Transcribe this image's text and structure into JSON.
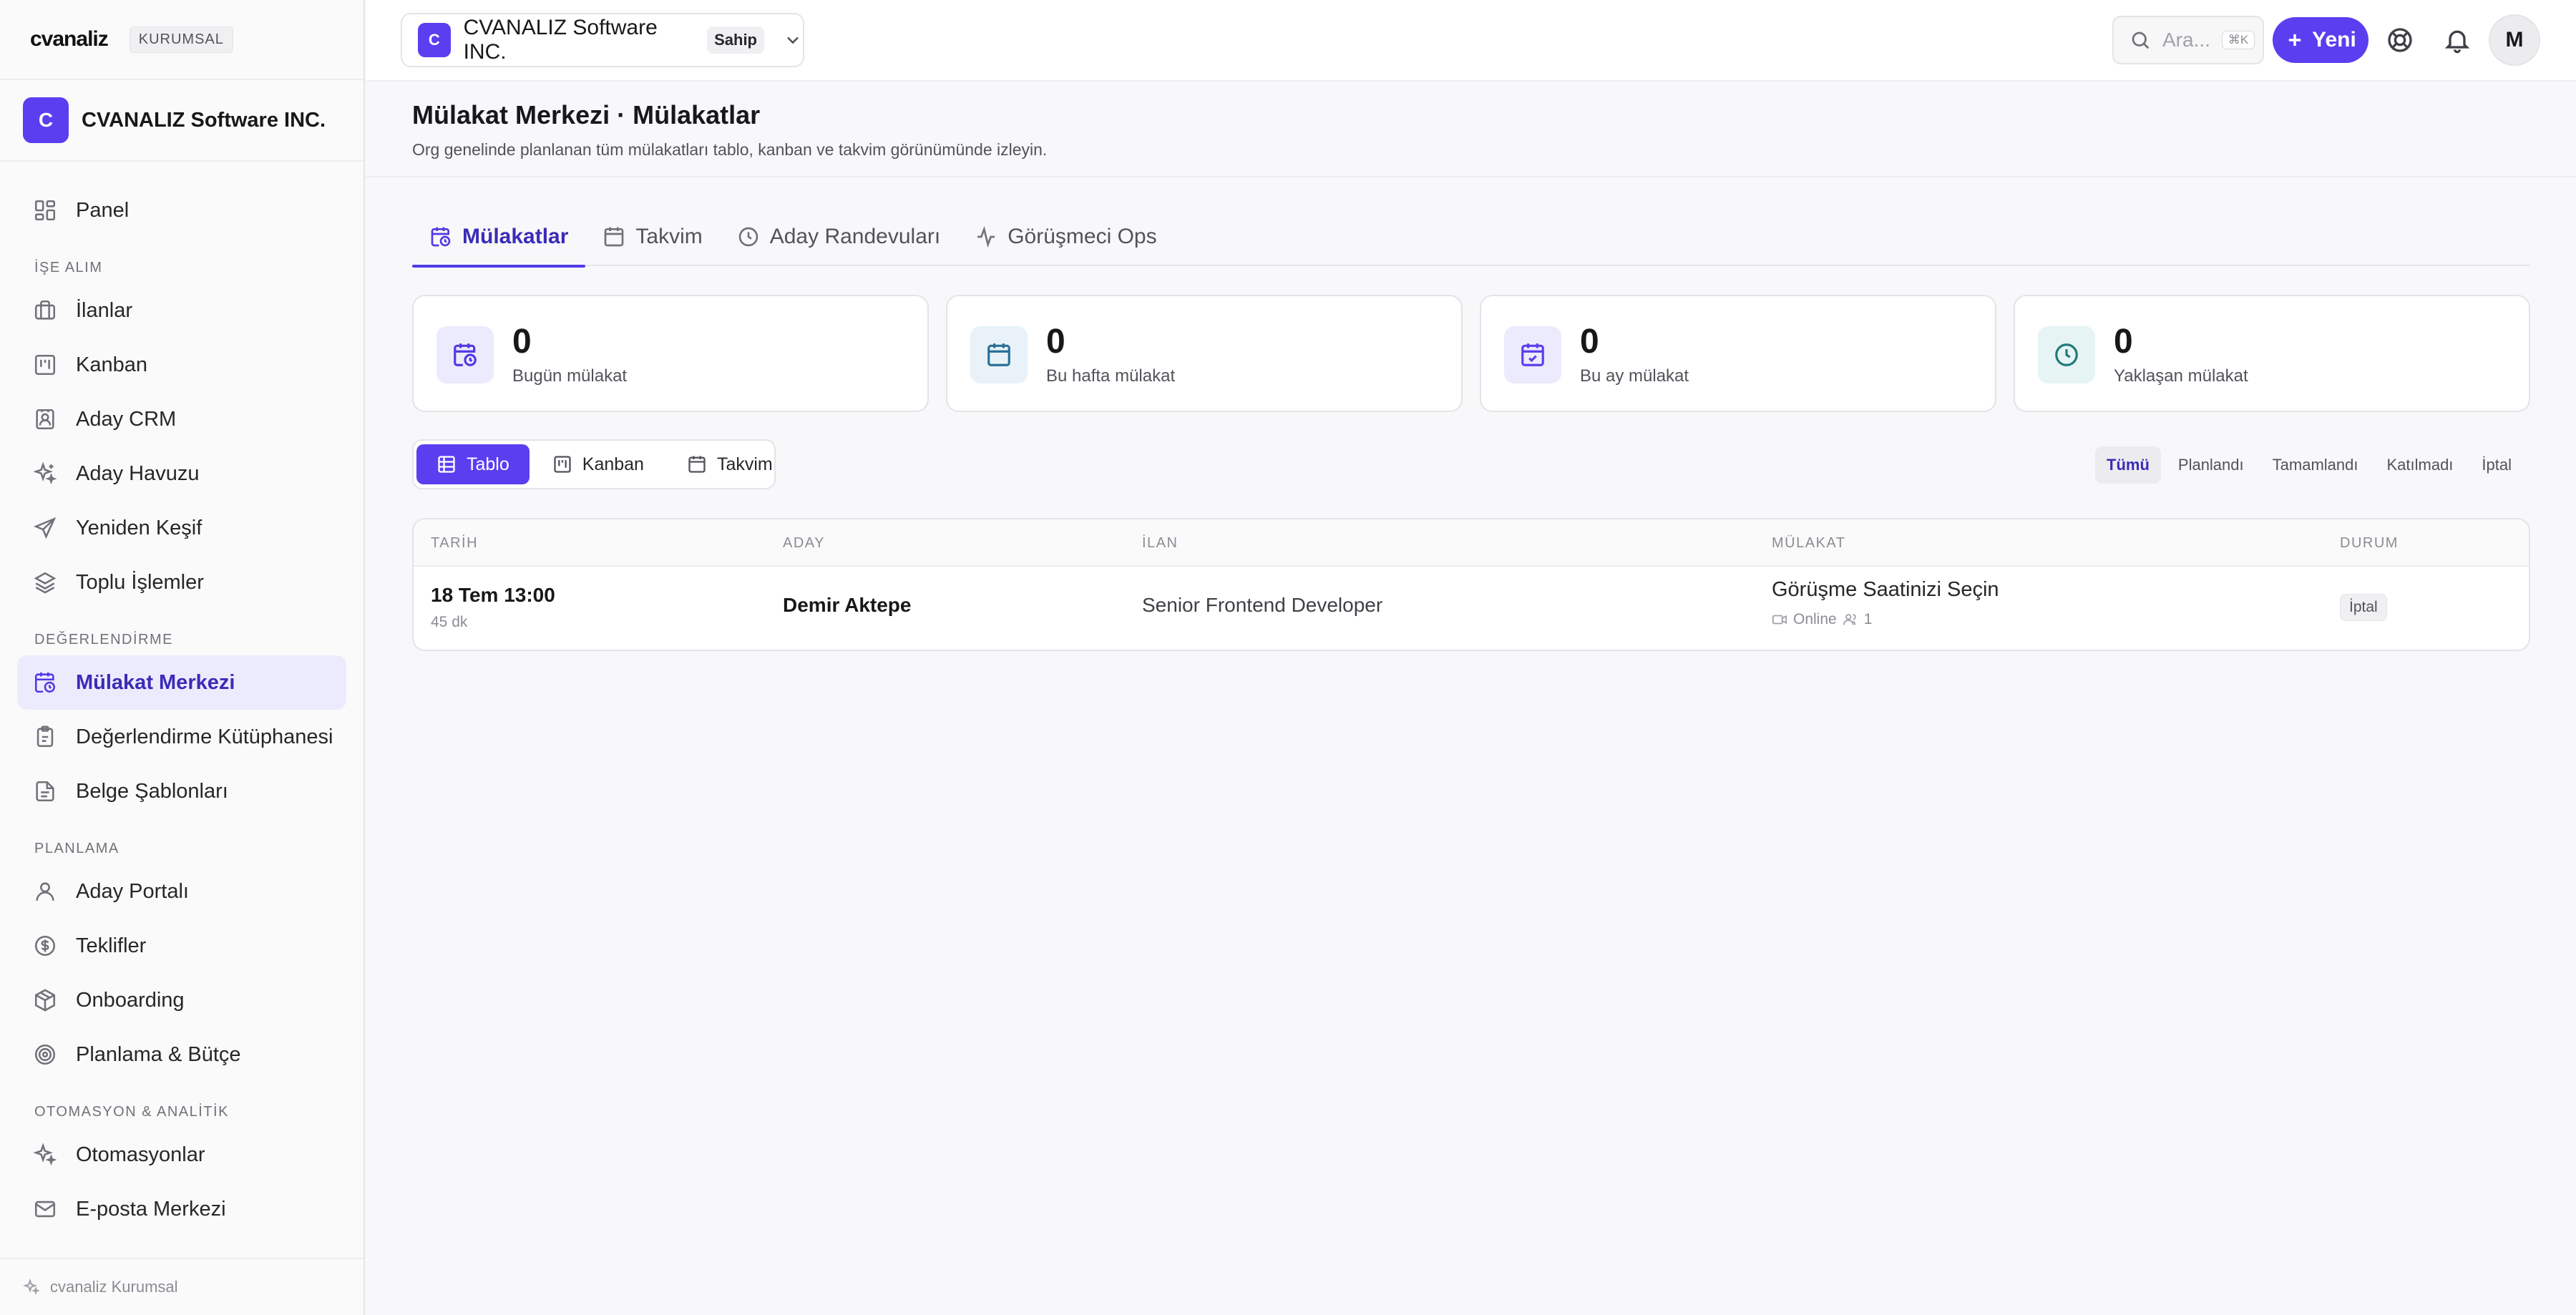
{
  "brand": {
    "name": "cvanaliz",
    "tag": "KURUMSAL"
  },
  "org": {
    "initial": "C",
    "name": "CVANALIZ Software INC.",
    "role": "Sahip"
  },
  "sidebar": {
    "top_item": {
      "label": "Panel",
      "icon": "dashboard-icon"
    },
    "groups": [
      {
        "title": "İŞE ALIM",
        "items": [
          {
            "label": "İlanlar",
            "icon": "briefcase-icon"
          },
          {
            "label": "Kanban",
            "icon": "kanban-icon"
          },
          {
            "label": "Aday CRM",
            "icon": "contact-icon"
          },
          {
            "label": "Aday Havuzu",
            "icon": "sparkles-icon"
          },
          {
            "label": "Yeniden Keşif",
            "icon": "send-icon"
          },
          {
            "label": "Toplu İşlemler",
            "icon": "layers-icon"
          }
        ]
      },
      {
        "title": "DEĞERLENDİRME",
        "items": [
          {
            "label": "Mülakat Merkezi",
            "icon": "calendar-clock-icon",
            "active": true
          },
          {
            "label": "Değerlendirme Kütüphanesi",
            "icon": "clipboard-icon"
          },
          {
            "label": "Belge Şablonları",
            "icon": "file-icon"
          }
        ]
      },
      {
        "title": "PLANLAMA",
        "items": [
          {
            "label": "Aday Portalı",
            "icon": "user-icon"
          },
          {
            "label": "Teklifler",
            "icon": "dollar-circle-icon"
          },
          {
            "label": "Onboarding",
            "icon": "package-icon"
          },
          {
            "label": "Planlama & Bütçe",
            "icon": "target-icon"
          }
        ]
      },
      {
        "title": "OTOMASYON & ANALİTİK",
        "items": [
          {
            "label": "Otomasyonlar",
            "icon": "sparkles-icon"
          },
          {
            "label": "E-posta Merkezi",
            "icon": "mail-icon"
          }
        ]
      }
    ],
    "footer": "cvanaliz Kurumsal"
  },
  "topbar": {
    "search_placeholder": "Ara...",
    "search_shortcut": "⌘K",
    "new_label": "Yeni",
    "avatar_initial": "M"
  },
  "page": {
    "title": "Mülakat Merkezi · Mülakatlar",
    "subtitle": "Org genelinde planlanan tüm mülakatları tablo, kanban ve takvim görünümünde izleyin."
  },
  "tabs": [
    {
      "label": "Mülakatlar",
      "active": true
    },
    {
      "label": "Takvim"
    },
    {
      "label": "Aday Randevuları"
    },
    {
      "label": "Görüşmeci Ops"
    }
  ],
  "stats": [
    {
      "value": "0",
      "label": "Bugün mülakat",
      "color": "#4f3ae6",
      "bg": "#ecebfd"
    },
    {
      "value": "0",
      "label": "Bu hafta mülakat",
      "color": "#2a6f97",
      "bg": "#e8f2f8"
    },
    {
      "value": "0",
      "label": "Bu ay mülakat",
      "color": "#5b3ef0",
      "bg": "#ecebfd"
    },
    {
      "value": "0",
      "label": "Yaklaşan mülakat",
      "color": "#1f7a7a",
      "bg": "#e6f4f4"
    }
  ],
  "views": [
    {
      "label": "Tablo",
      "active": true
    },
    {
      "label": "Kanban"
    },
    {
      "label": "Takvim"
    }
  ],
  "filters": [
    {
      "label": "Tümü",
      "active": true
    },
    {
      "label": "Planlandı"
    },
    {
      "label": "Tamamlandı"
    },
    {
      "label": "Katılmadı"
    },
    {
      "label": "İptal"
    }
  ],
  "table": {
    "columns": [
      "TARİH",
      "ADAY",
      "İLAN",
      "MÜLAKAT",
      "DURUM"
    ],
    "rows": [
      {
        "date": "18 Tem 13:00",
        "duration": "45 dk",
        "candidate": "Demir Aktepe",
        "job": "Senior Frontend Developer",
        "interview_title": "Görüşme Saatinizi Seçin",
        "mode": "Online",
        "participants": "1",
        "status": "İptal"
      }
    ]
  }
}
